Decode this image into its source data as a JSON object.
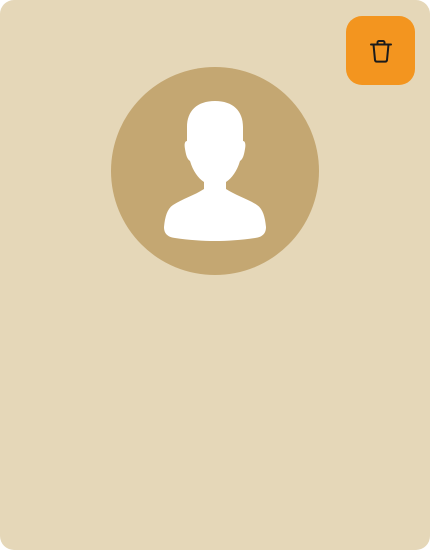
{
  "card": {
    "background_color": "#e5d7b8"
  },
  "delete_button": {
    "icon": "trash-icon",
    "background_color": "#f3951f"
  },
  "avatar": {
    "icon": "person-silhouette-icon",
    "background_color": "#c4a772"
  }
}
